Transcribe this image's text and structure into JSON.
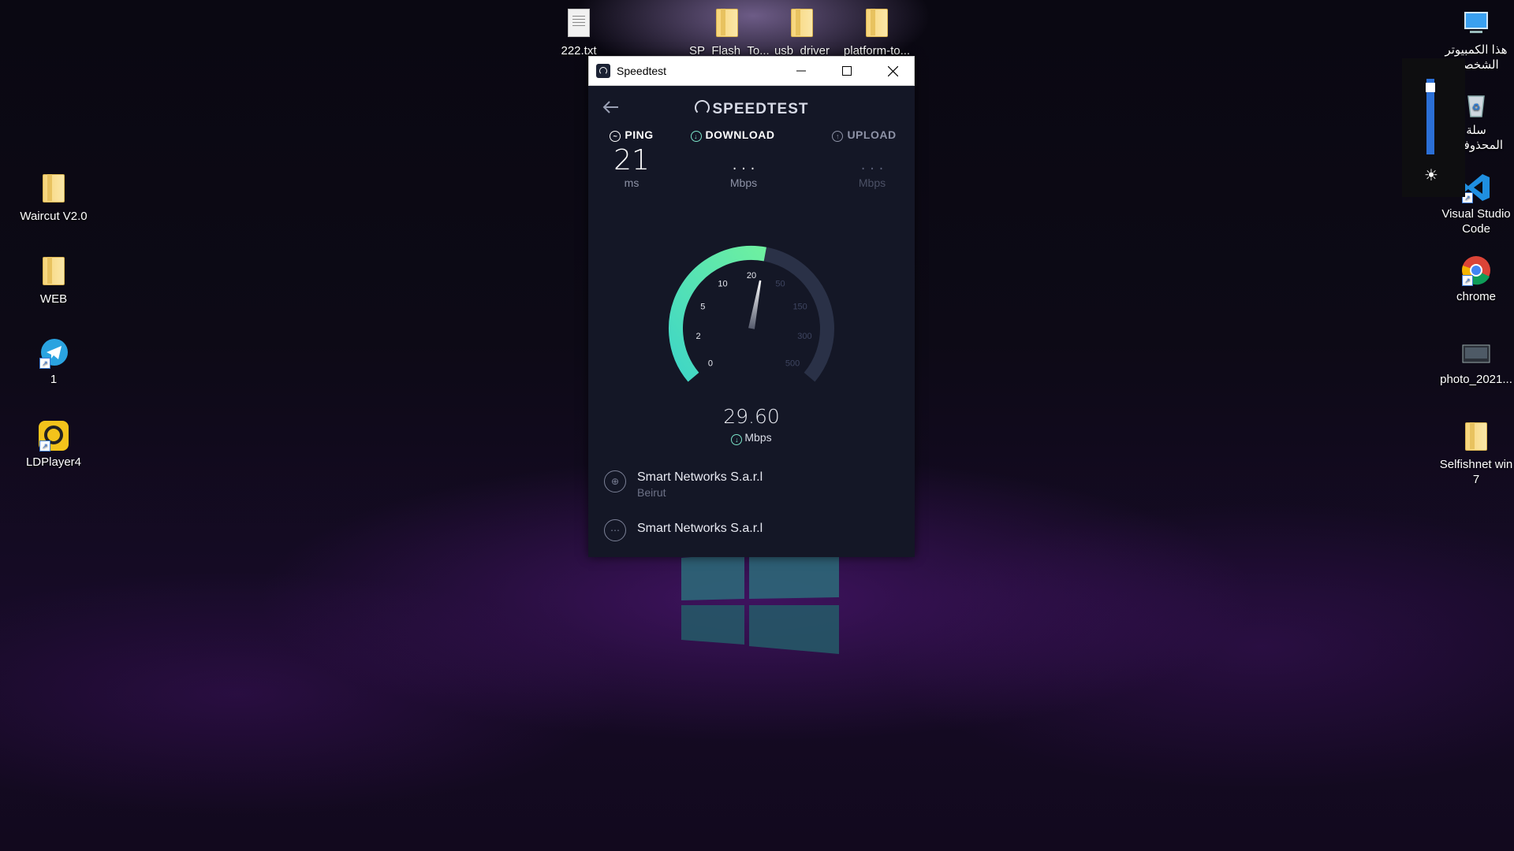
{
  "desktop": {
    "left_icons": [
      {
        "label": "Waircut V2.0",
        "icon": "folder-icon"
      },
      {
        "label": "WEB",
        "icon": "folder-icon"
      },
      {
        "label": "1",
        "icon": "telegram-icon"
      },
      {
        "label": "LDPlayer4",
        "icon": "ldplayer-icon"
      }
    ],
    "top_icons": [
      {
        "label": "222.txt",
        "icon": "text-file-icon"
      },
      {
        "label": "SP_Flash_To...",
        "icon": "folder-icon"
      },
      {
        "label": "usb_driver",
        "icon": "folder-icon"
      },
      {
        "label": "platform-to...",
        "icon": "folder-icon"
      }
    ],
    "right_icons": [
      {
        "label": "هذا الكمبيوتر الشخصي",
        "icon": "this-pc-icon"
      },
      {
        "label": "سلة المحذوفات",
        "icon": "recycle-bin-icon"
      },
      {
        "label": "Visual Studio Code",
        "icon": "vscode-icon"
      },
      {
        "label": "chrome",
        "icon": "chrome-icon"
      },
      {
        "label": "photo_2021...",
        "icon": "image-file-icon"
      },
      {
        "label": "Selfishnet win 7",
        "icon": "folder-icon"
      }
    ]
  },
  "speedtest": {
    "window_title": "Speedtest",
    "brand": "SPEEDTEST",
    "ping": {
      "label": "PING",
      "value": "21",
      "unit": "ms"
    },
    "download": {
      "label": "DOWNLOAD",
      "value": "...",
      "unit": "Mbps"
    },
    "upload": {
      "label": "UPLOAD",
      "value": "...",
      "unit": "Mbps"
    },
    "gauge": {
      "ticks": [
        "0",
        "2",
        "5",
        "10",
        "20",
        "50",
        "150",
        "300",
        "500"
      ],
      "reading": "29.60",
      "reading_value": 29.6,
      "unit": "Mbps",
      "arc_color": "#6ef0a0",
      "arc_color_start": "#3fd6c6",
      "track_color": "#2a3147"
    },
    "servers": [
      {
        "name": "Smart Networks S.a.r.l",
        "sub": "Beirut",
        "icon": "globe-icon"
      },
      {
        "name": "Smart Networks S.a.r.l",
        "sub": "",
        "icon": "isp-icon"
      }
    ],
    "accent": "#7be3c8"
  },
  "brightness": {
    "level": 0.95
  }
}
